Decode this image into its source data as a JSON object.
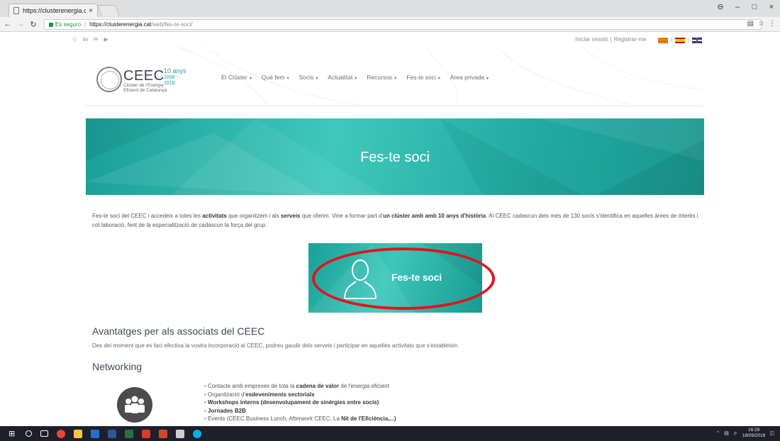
{
  "browser": {
    "tab_title": "https://clusterenergia.cat",
    "tab_close": "×",
    "secure_label": "Es seguro",
    "url_host": "https://clusterenergia.cat",
    "url_path": "/web/fes-te-soci/",
    "window_controls": [
      "⊖",
      "–",
      "□",
      "×"
    ]
  },
  "topbar": {
    "social_icons": [
      "twitter-icon",
      "linkedin-icon",
      "mail-icon",
      "youtube-icon"
    ],
    "social_glyphs": [
      "✩",
      "in",
      "✉",
      "▶"
    ],
    "login": "Iniciar sessió",
    "register": "Registrar-me",
    "pipe": "|"
  },
  "logo": {
    "name": "CEEC",
    "years": "10 anys",
    "years_range": "2008 - 2018",
    "sub1": "Clúster de l'Energia",
    "sub2": "Eficient de Catalunya"
  },
  "nav": {
    "items": [
      "El Clúster",
      "Què fem",
      "Socis",
      "Actualitat",
      "Recursos",
      "Fes-te soci",
      "Àrea privada"
    ],
    "caret": "▾"
  },
  "hero": {
    "title": "Fes-te soci"
  },
  "intro": {
    "p1": "Fes-te soci del CEEC i accedeix a totes les ",
    "b1": "activitats",
    "p2": " que organitzem i als ",
    "b2": "serveis",
    "p3": " que oferim. Vine a formar part d'",
    "b3": "un clúster amb amb 10 anys d'història",
    "p4": ". Al CEEC cadascun dels més de 130 socis s'identifica en aquelles àrees de interès i col·laboració, fent de la especialització de cadascun la força del grup."
  },
  "cta": {
    "label": "Fes-te soci"
  },
  "advantages": {
    "title": "Avantatges per als associats del CEEC",
    "desc": "Des del moment que es faci efectiva la vostra incorporació al CEEC, podreu gaudir dels serveis i participar en aquelles activitats que s'estableixin."
  },
  "networking": {
    "title": "Networking",
    "b1_pre": "Contacte amb empreses de tota la ",
    "b1_bold": "cadena de valor",
    "b1_post": " de l'energia eficient",
    "b2_pre": "Organització d'",
    "b2_bold": "esdeveniments sectorials",
    "b3_bold": "Workshops interns (desenvolupament de sinérgies entre socis)",
    "b4_bold": "Jornades B2B",
    "b5_pre": "Events (CEEC Business Lunch, Afterwork CEEC, La ",
    "b5_bold": "Nit de l'Eficiència,...)"
  },
  "taskbar": {
    "time": "16:29",
    "date": "18/09/2018",
    "apps": [
      "windows-start-icon",
      "search-icon",
      "task-view-icon",
      "chrome-icon",
      "file-explorer-icon",
      "outlook-icon",
      "word-icon",
      "excel-icon",
      "acrobat-icon",
      "powerpoint-icon",
      "calculator-icon",
      "skype-icon"
    ],
    "app_colors": [
      "#ffffff",
      "#ffffff",
      "#ffffff",
      "#e8453c",
      "#f4c542",
      "#1e73c7",
      "#2b579a",
      "#217346",
      "#d83b2b",
      "#d24726",
      "#cfcfcf",
      "#00aff0"
    ]
  },
  "colors": {
    "accent_teal": "#22aca2",
    "highlight_red": "#e0141e"
  }
}
